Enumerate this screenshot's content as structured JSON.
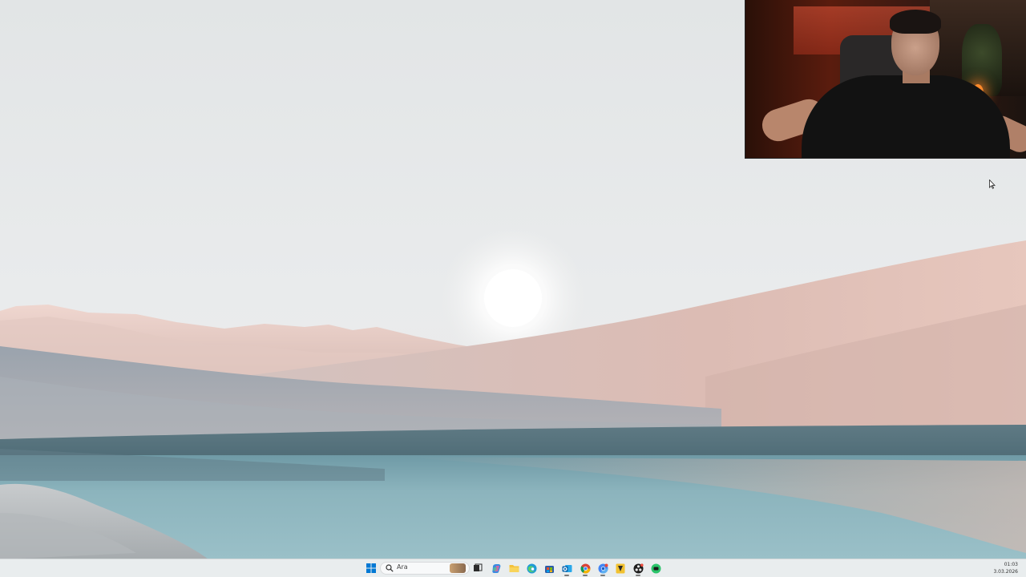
{
  "taskbar": {
    "search_placeholder": "Ara",
    "clock_time": "01:03",
    "clock_date": "3.03.2026",
    "pinned_icons": [
      "start-icon",
      "search-icon",
      "search-widget-icon",
      "task-view-icon",
      "copilot-icon",
      "file-explorer-icon",
      "edge-icon",
      "microsoft-store-icon",
      "outlook-icon",
      "chrome-icon",
      "chrome-profile-icon",
      "app-yellow-icon",
      "obs-icon",
      "green-app-icon"
    ]
  },
  "colors": {
    "sky": "#e6e9ea",
    "dune": "#d7b9b0",
    "water": "#8fb6bf",
    "taskbar": "#e8ecee",
    "accent": "#0078d4"
  }
}
